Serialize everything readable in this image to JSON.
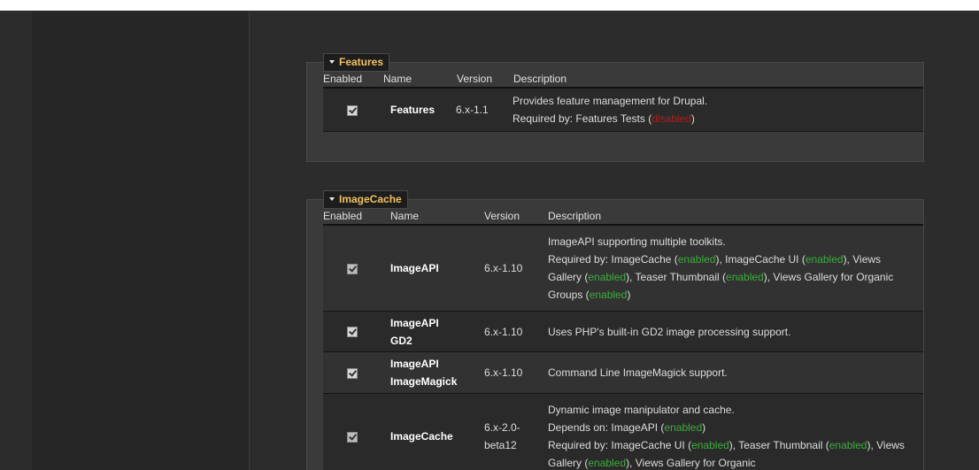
{
  "groups": {
    "features": {
      "legend": "Features",
      "headers": {
        "enabled": "Enabled",
        "name": "Name",
        "version": "Version",
        "description": "Description"
      },
      "modules": [
        {
          "name": "Features",
          "version": "6.x-1.1",
          "description": "Provides feature management for Drupal.",
          "required_prefix": "Required by: Features Tests (",
          "required_status": "disabled",
          "required_suffix": ")"
        }
      ]
    },
    "imagecache": {
      "legend": "ImageCache",
      "headers": {
        "enabled": "Enabled",
        "name": "Name",
        "version": "Version",
        "description": "Description"
      },
      "modules": [
        {
          "name": "ImageAPI",
          "version": "6.x-1.10",
          "description": "ImageAPI supporting multiple toolkits.",
          "req_label": "Required by: ",
          "req": [
            {
              "name": "ImageCache (",
              "status": "enabled",
              "after": "), "
            },
            {
              "name": "ImageCache UI (",
              "status": "enabled",
              "after": "), "
            },
            {
              "name": "Views Gallery (",
              "status": "enabled",
              "after": "), "
            },
            {
              "name": "Teaser Thumbnail (",
              "status": "enabled",
              "after": "), "
            },
            {
              "name": "Views Gallery for Organic Groups (",
              "status": "enabled",
              "after": ")"
            }
          ]
        },
        {
          "name_line1": "ImageAPI",
          "name_line2": "GD2",
          "version": "6.x-1.10",
          "description": "Uses PHP's built-in GD2 image processing support."
        },
        {
          "name_line1": "ImageAPI",
          "name_line2": "ImageMagick",
          "version": "6.x-1.10",
          "description": "Command Line ImageMagick support."
        },
        {
          "name": "ImageCache",
          "version_line1": "6.x-2.0-",
          "version_line2": "beta12",
          "description": "Dynamic image manipulator and cache.",
          "dep_label": "Depends on: ImageAPI (",
          "dep_status": "enabled",
          "dep_after": ")",
          "req_label": "Required by: ",
          "req": [
            {
              "name": "ImageCache UI (",
              "status": "enabled",
              "after": "), "
            },
            {
              "name": "Teaser Thumbnail (",
              "status": "enabled",
              "after": "), "
            },
            {
              "name": "Views Gallery (",
              "status": "enabled",
              "after": "), "
            },
            {
              "name": "Views Gallery for Organic",
              "status": "",
              "after": ""
            }
          ]
        }
      ]
    }
  }
}
